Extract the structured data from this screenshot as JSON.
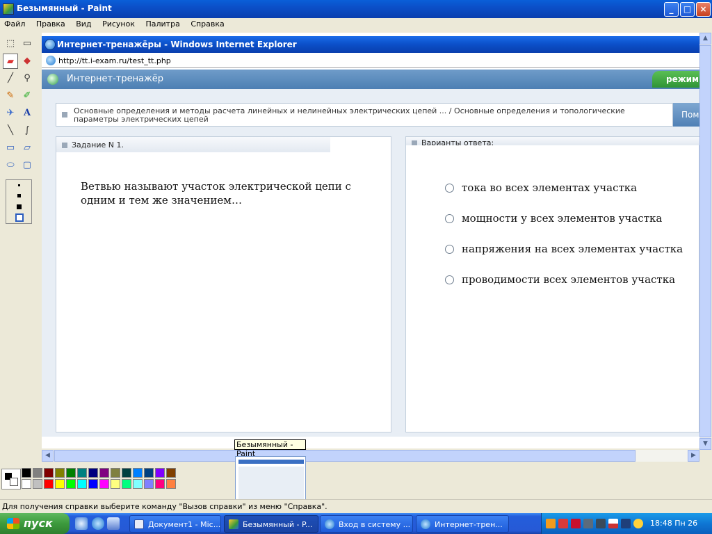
{
  "window": {
    "title": "Безымянный - Paint",
    "btn_min": "_",
    "btn_max": "□",
    "btn_close": "×"
  },
  "menu": [
    "Файл",
    "Правка",
    "Вид",
    "Рисунок",
    "Палитра",
    "Справка"
  ],
  "tools": [
    "free-select",
    "rect-select",
    "eraser",
    "fill",
    "color-picker",
    "magnifier",
    "pencil",
    "brush",
    "airbrush",
    "text",
    "line",
    "curve",
    "rectangle",
    "polygon",
    "ellipse",
    "rounded-rect"
  ],
  "ie": {
    "title": "Интернет-тренажёры - Windows Internet Explorer",
    "url": "http://tt.i-exam.ru/test_tt.php"
  },
  "site": {
    "name": "Интернет-тренажёр",
    "mode_label": "режим",
    "breadcrumb": "Основные определения и методы расчета линейных и нелинейных электрических цепей ... / Основные определения и топологические параметры электрических цепей",
    "help_label": "Пом",
    "task_label": "Задание N 1.",
    "answers_label": "Варианты ответа:",
    "question": "Ветвью называют участок электрической цепи с одним и тем же значением…",
    "answers": [
      "тока во всех элементах участка",
      "мощности у всех элементов участка",
      "напряжения на всех элементах участка",
      "проводимости всех элементов участка"
    ]
  },
  "palette": [
    "#000000",
    "#808080",
    "#800000",
    "#808000",
    "#008000",
    "#008080",
    "#000080",
    "#800080",
    "#808040",
    "#004040",
    "#0080ff",
    "#004080",
    "#8000ff",
    "#804000",
    "#ffffff",
    "#c0c0c0",
    "#ff0000",
    "#ffff00",
    "#00ff00",
    "#00ffff",
    "#0000ff",
    "#ff00ff",
    "#ffff80",
    "#00ff80",
    "#80ffff",
    "#8080ff",
    "#ff0080",
    "#ff8040"
  ],
  "tooltip": "Безымянный - Paint",
  "status": "Для получения справки выберите команду \"Вызов справки\" из меню \"Справка\".",
  "taskbar": {
    "start": "пуск",
    "tasks": [
      "Документ1 - Mic...",
      "Безымянный - P...",
      "Вход в систему ...",
      "Интернет-трен..."
    ],
    "clock": "18:48 Пн 26"
  }
}
